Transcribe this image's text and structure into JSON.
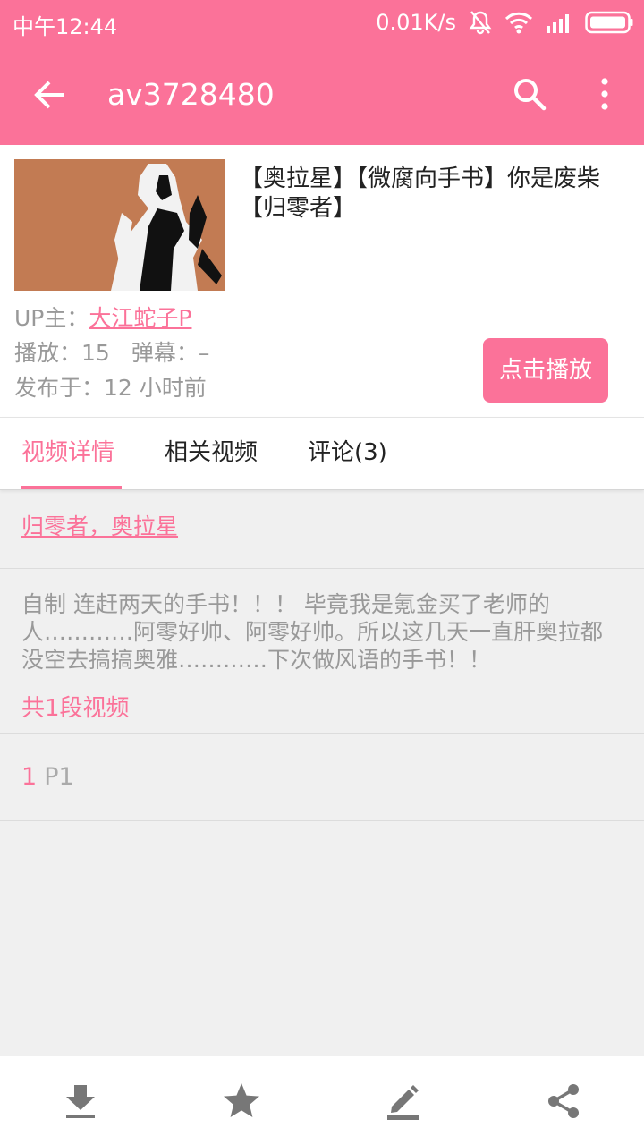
{
  "status_bar": {
    "time": "中午12:44",
    "net_speed": "0.01K/s",
    "icons": [
      "mute-icon",
      "wifi-icon",
      "signal-icon",
      "battery-icon"
    ]
  },
  "toolbar": {
    "title": "av3728480",
    "icons": [
      "back-arrow-icon",
      "search-icon",
      "more-vert-icon"
    ]
  },
  "video": {
    "title": "【奥拉星】【微腐向手书】你是废柴【归零者】",
    "up_label": "UP主：",
    "up_name": "大江蛇子P",
    "play_label": "播放：",
    "play_count": "15",
    "danmaku_label": "弹幕：",
    "danmaku_count": "–",
    "published": "发布于：12 小时前",
    "play_button": "点击播放"
  },
  "tabs": [
    {
      "label": "视频详情",
      "active": true
    },
    {
      "label": "相关视频",
      "active": false
    },
    {
      "label": "评论(3)",
      "active": false
    }
  ],
  "detail": {
    "tags": "归零者，奥拉星",
    "description": "自制 连赶两天的手书！！！ 毕竟我是氪金买了老师的人…………阿零好帅、阿零好帅。所以这几天一直肝奥拉都没空去搞搞奥雅…………下次做风语的手书！！",
    "parts_count": "共1段视频",
    "parts": [
      {
        "index": "1",
        "name": "P1"
      }
    ]
  },
  "bottom_bar": {
    "icons": [
      "download-icon",
      "star-icon",
      "edit-icon",
      "share-icon"
    ]
  },
  "colors": {
    "accent": "#fb7299",
    "background": "#f0f0f0",
    "muted_text": "#999999"
  }
}
